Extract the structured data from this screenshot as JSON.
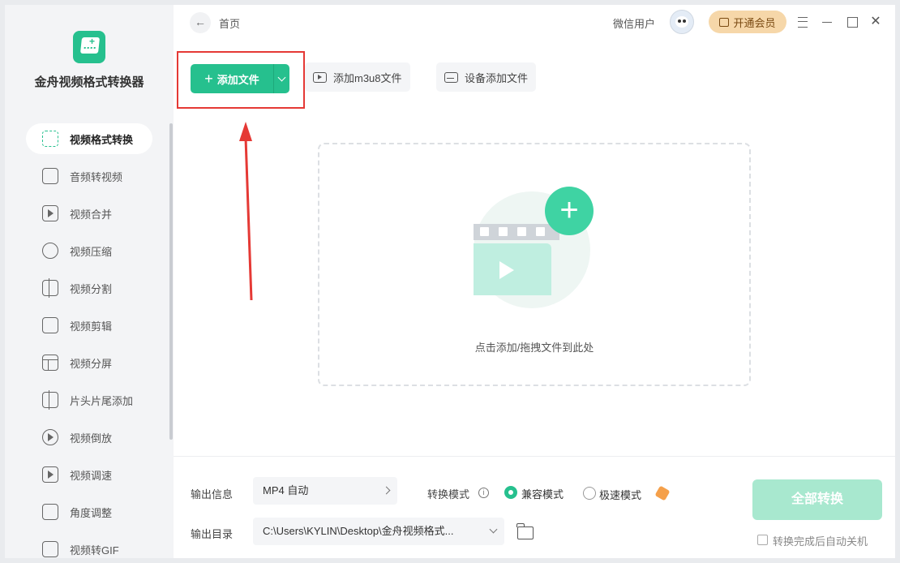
{
  "app": {
    "name": "金舟视频格式转换器"
  },
  "sidebar": {
    "items": [
      {
        "label": "视频格式转换",
        "icon": "convert-icon",
        "active": true
      },
      {
        "label": "音频转视频",
        "icon": "audio-to-video-icon",
        "active": false
      },
      {
        "label": "视频合并",
        "icon": "merge-icon",
        "active": false
      },
      {
        "label": "视频压缩",
        "icon": "compress-icon",
        "active": false
      },
      {
        "label": "视频分割",
        "icon": "split-icon",
        "active": false
      },
      {
        "label": "视频剪辑",
        "icon": "scissors-icon",
        "active": false
      },
      {
        "label": "视频分屏",
        "icon": "split-screen-icon",
        "active": false
      },
      {
        "label": "片头片尾添加",
        "icon": "film-strip-icon",
        "active": false
      },
      {
        "label": "视频倒放",
        "icon": "rewind-icon",
        "active": false
      },
      {
        "label": "视频调速",
        "icon": "speed-icon",
        "active": false
      },
      {
        "label": "角度调整",
        "icon": "rotate-icon",
        "active": false
      },
      {
        "label": "视频转GIF",
        "icon": "gif-icon",
        "active": false
      }
    ]
  },
  "header": {
    "breadcrumb": "首页",
    "username": "微信用户",
    "vip_label": "开通会员"
  },
  "toolbar": {
    "add_file": "添加文件",
    "add_m3u8": "添加m3u8文件",
    "device_add": "设备添加文件"
  },
  "dropzone": {
    "hint": "点击添加/拖拽文件到此处"
  },
  "bottom": {
    "output_info_label": "输出信息",
    "output_format": "MP4 自动",
    "mode_label": "转换模式",
    "mode_compat": "兼容模式",
    "mode_fast": "极速模式",
    "output_dir_label": "输出目录",
    "output_dir": "C:\\Users\\KYLIN\\Desktop\\金舟视频格式...",
    "convert_all": "全部转换",
    "auto_shutdown": "转换完成后自动关机"
  },
  "colors": {
    "accent": "#26c08e",
    "highlight": "#e53935",
    "vip": "#f6d7a9"
  }
}
